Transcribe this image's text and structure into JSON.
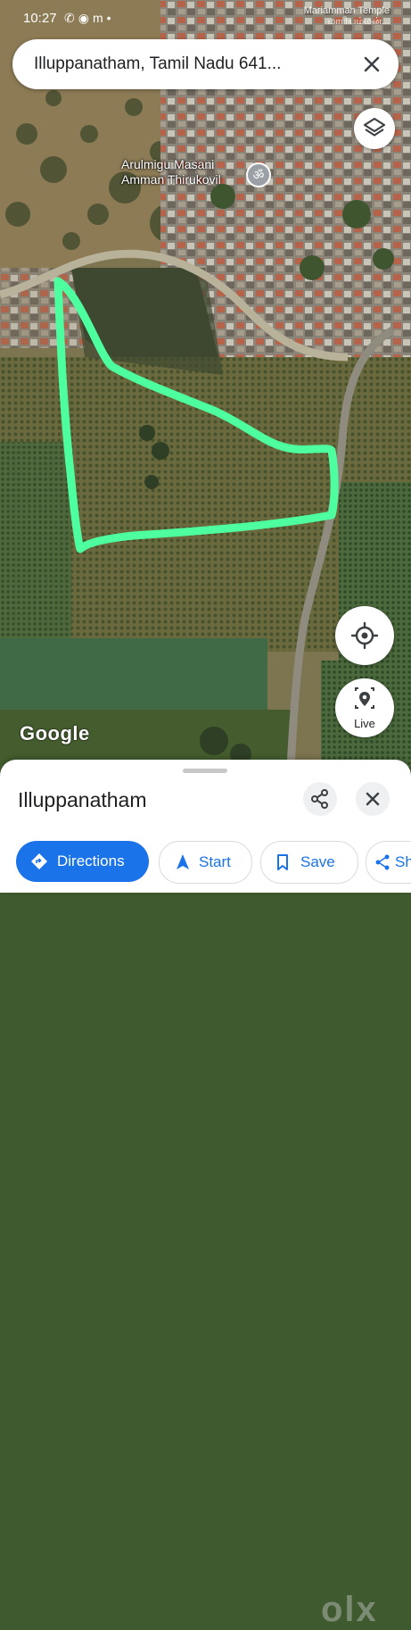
{
  "status_bar": {
    "time": "10:27",
    "icons": [
      "whatsapp-icon",
      "messenger-icon",
      "m-icon",
      "dot"
    ],
    "top_right_text_line1": "Mariamman Temple",
    "top_right_text_line2": "மாரியம்மன்..."
  },
  "search": {
    "query": "Illuppanatham, Tamil Nadu 641..."
  },
  "map": {
    "poi": {
      "name_line1": "Arulmigu Masani",
      "name_line2": "Amman Thirukovil",
      "icon": "om-icon"
    },
    "attribution": "Google",
    "boundary_color": "#4dff9e"
  },
  "controls": {
    "layers_icon": "layers-icon",
    "my_location_icon": "my-location-icon",
    "live_label": "Live"
  },
  "sheet": {
    "title": "Illuppanatham",
    "actions": {
      "directions": "Directions",
      "start": "Start",
      "save": "Save",
      "share": "Sh"
    },
    "accent": "#1a73e8"
  }
}
